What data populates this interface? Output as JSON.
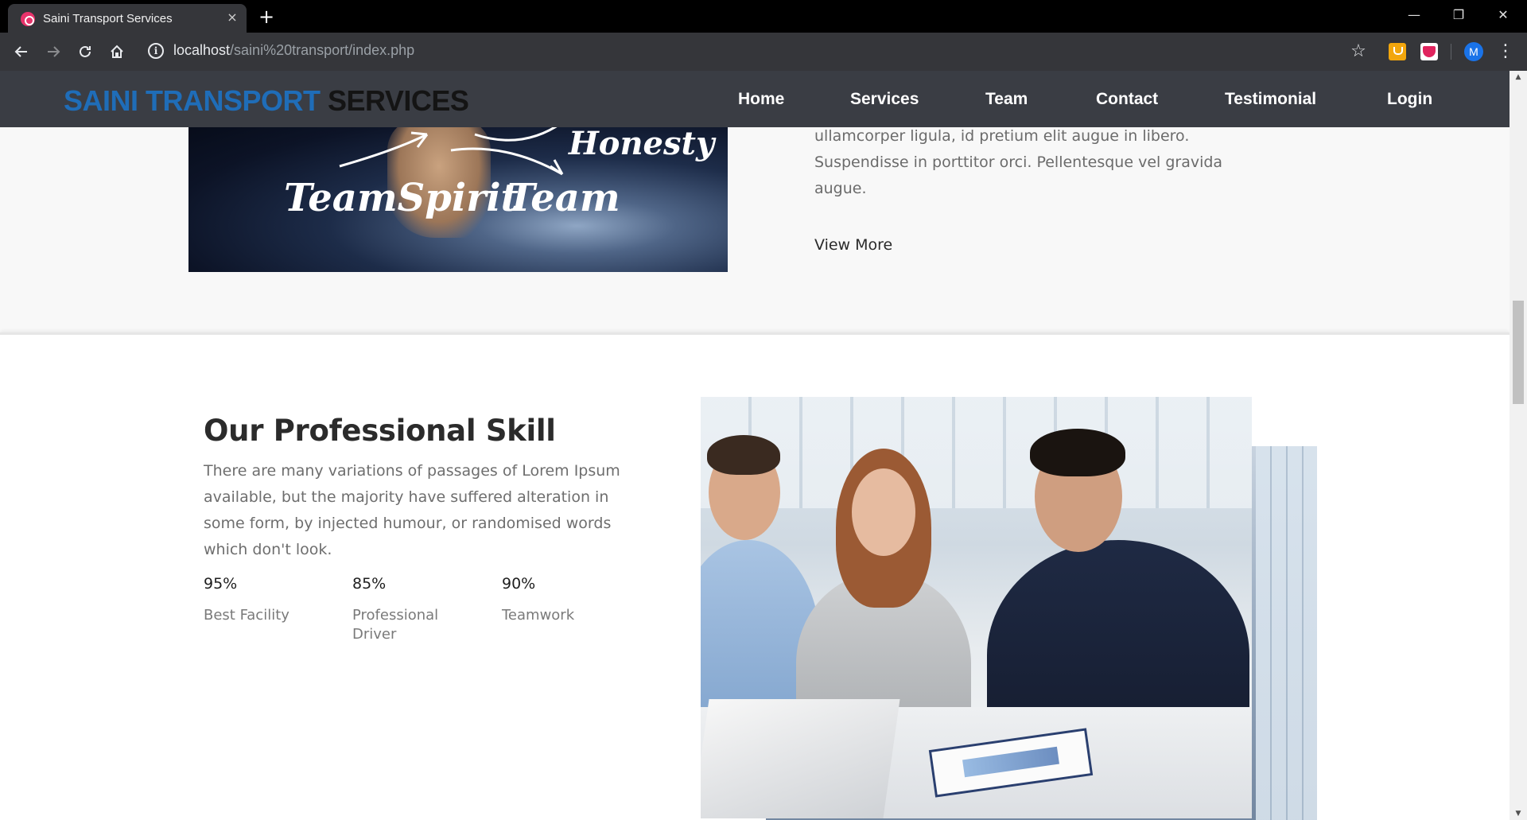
{
  "browser": {
    "tab_title": "Saini Transport Services",
    "tab_close": "×",
    "new_tab": "+",
    "url_host": "localhost",
    "url_path": "/saini%20transport/index.php",
    "avatar_initial": "M",
    "window_controls": {
      "minimize": "—",
      "restore": "❐",
      "close": "✕"
    },
    "icons": [
      "back-icon",
      "forward-icon",
      "reload-icon",
      "home-icon",
      "info-icon",
      "star-icon",
      "extension-icon",
      "pocket-icon",
      "menu-icon"
    ]
  },
  "site": {
    "logo_part1": "SAINI TRANSPORT",
    "logo_part2": "SERVICES",
    "nav": [
      "Home",
      "Services",
      "Team",
      "Contact",
      "Testimonial",
      "Login"
    ]
  },
  "about": {
    "image_words": [
      "Honesty",
      "TeamSpirit",
      "Team"
    ],
    "text": "ullamcorper ligula, id pretium elit augue in libero. Suspendisse in porttitor orci. Pellentesque vel gravida augue.",
    "view_more": "View More"
  },
  "skill": {
    "title": "Our Professional Skill",
    "text": "There are many variations of passages of Lorem Ipsum available, but the majority have suffered alteration in some form, by injected humour, or randomised words which don't look.",
    "stats": [
      {
        "value": "95%",
        "label": "Best Facility"
      },
      {
        "value": "85%",
        "label": "Professional Driver"
      },
      {
        "value": "90%",
        "label": "Teamwork"
      }
    ]
  },
  "colors": {
    "logo_blue": "#1f6db8",
    "header_bg": "#3a3d44",
    "browser_bg": "#35363a"
  }
}
